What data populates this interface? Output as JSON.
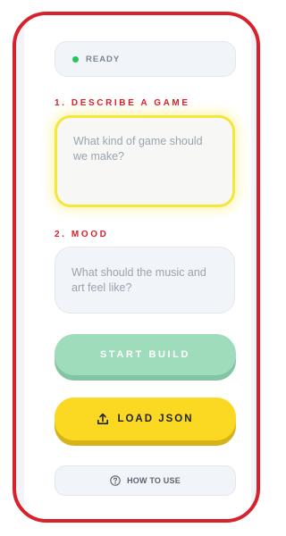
{
  "status": {
    "text": "READY",
    "indicator_color": "#22c55e"
  },
  "step1": {
    "label": "1. DESCRIBE A GAME",
    "placeholder": "What kind of game should we make?",
    "value": ""
  },
  "step2": {
    "label": "2. MOOD",
    "placeholder": "What should the music and art feel like?",
    "value": ""
  },
  "buttons": {
    "start_build": "START BUILD",
    "load_json": "LOAD JSON",
    "how_to_use": "HOW TO USE"
  },
  "icons": {
    "load_json": "upload-icon",
    "how_to_use": "question-circle-icon",
    "status": "status-dot-icon"
  },
  "colors": {
    "frame_border": "#d8212a",
    "section_label": "#d8212a",
    "active_field_border": "#f5e63b",
    "start_button": "#9edcbc",
    "load_button": "#fbd821"
  }
}
